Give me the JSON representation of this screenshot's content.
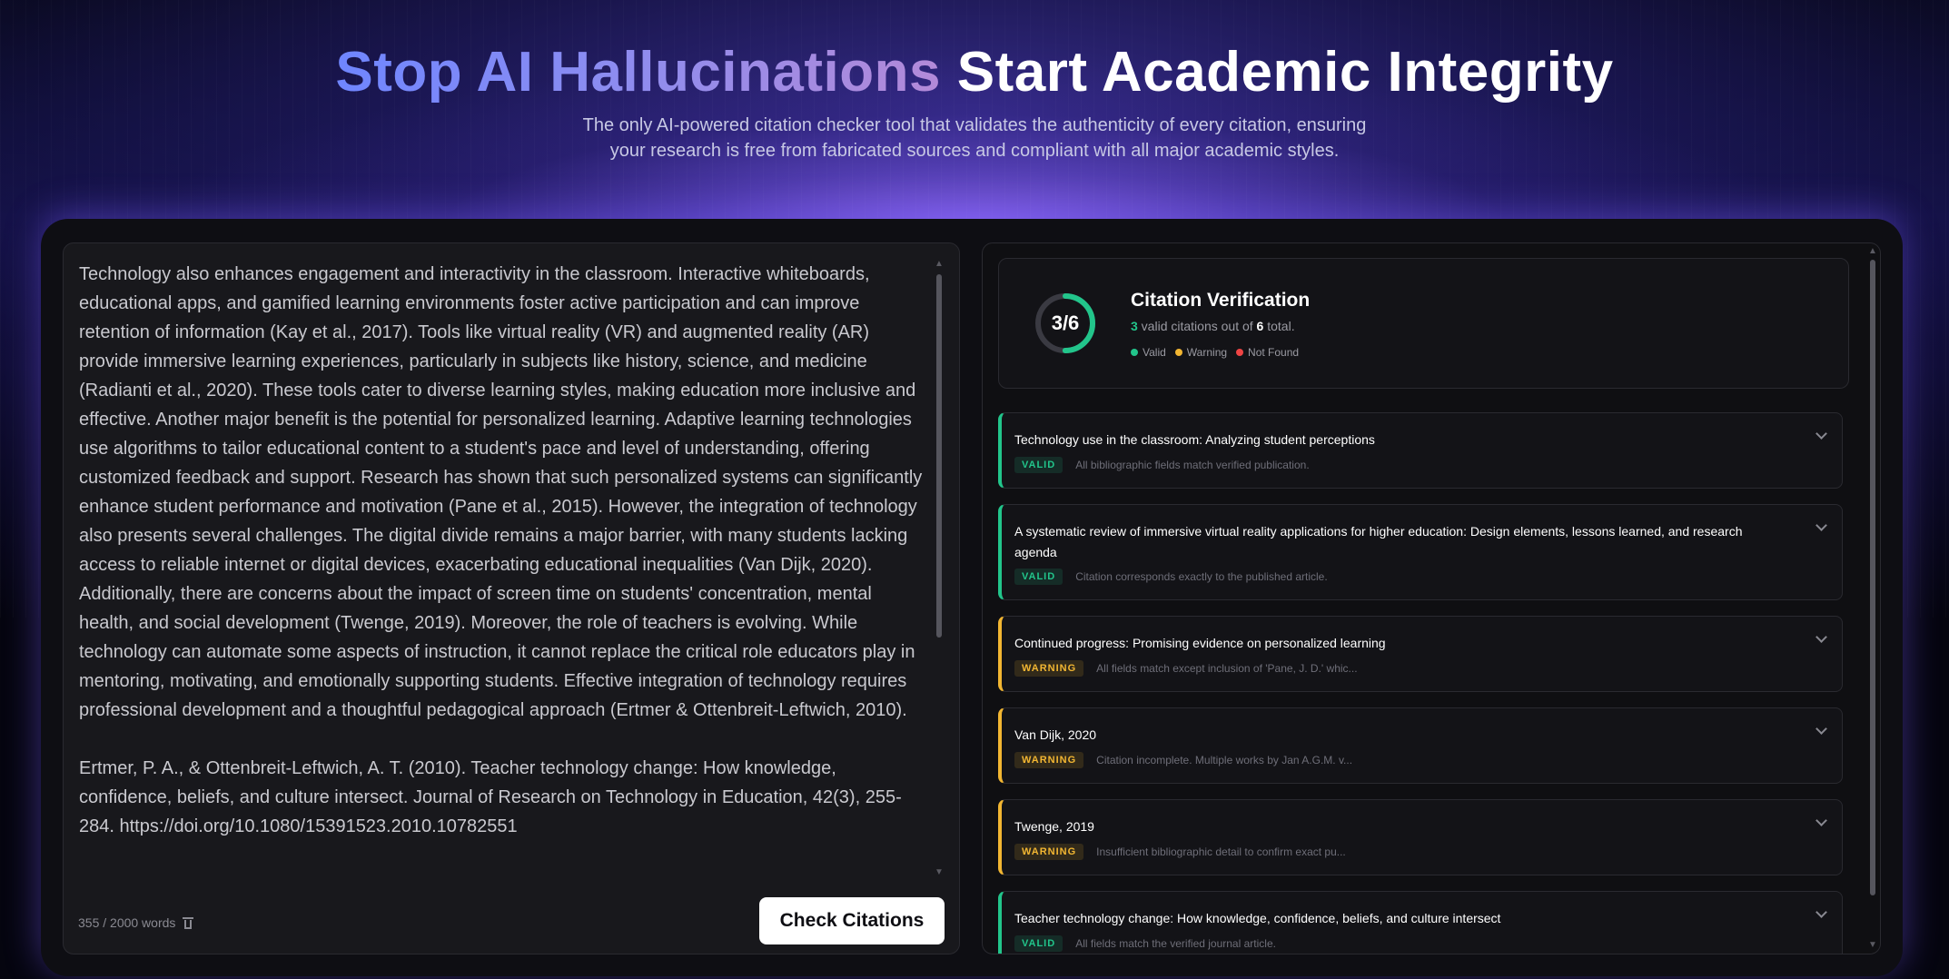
{
  "hero": {
    "title_accent": "Stop AI Hallucinations",
    "title_rest": "Start Academic Integrity",
    "subtitle": "The only AI-powered citation checker tool that validates the authenticity of every citation, ensuring your research is free from fabricated sources and compliant with all major academic styles."
  },
  "editor": {
    "paragraphs": [
      "Technology also enhances engagement and interactivity in the classroom. Interactive whiteboards, educational apps, and gamified learning environments foster active participation and can improve retention of information (Kay et al., 2017). Tools like virtual reality (VR) and augmented reality (AR) provide immersive learning experiences, particularly in subjects like history, science, and medicine (Radianti et al., 2020). These tools cater to diverse learning styles, making education more inclusive and effective. Another major benefit is the potential for personalized learning. Adaptive learning technologies use algorithms to tailor educational content to a student's pace and level of understanding, offering customized feedback and support. Research has shown that such personalized systems can significantly enhance student performance and motivation (Pane et al., 2015). However, the integration of technology also presents several challenges. The digital divide remains a major barrier, with many students lacking access to reliable internet or digital devices, exacerbating educational inequalities (Van Dijk, 2020). Additionally, there are concerns about the impact of screen time on students' concentration, mental health, and social development (Twenge, 2019). Moreover, the role of teachers is evolving. While technology can automate some aspects of instruction, it cannot replace the critical role educators play in mentoring, motivating, and emotionally supporting students. Effective integration of technology requires professional development and a thoughtful pedagogical approach (Ertmer & Ottenbreit-Leftwich, 2010).",
      "Ertmer, P. A., & Ottenbreit-Leftwich, A. T. (2010). Teacher technology change: How knowledge, confidence, beliefs, and culture intersect. Journal of Research on Technology in Education, 42(3), 255-284. https://doi.org/10.1080/15391523.2010.10782551"
    ],
    "word_count": "355 / 2000 words",
    "check_button": "Check Citations"
  },
  "summary": {
    "score": "3/6",
    "valid_fraction": 0.5,
    "title": "Citation Verification",
    "valid_count": "3",
    "mid_text": " valid citations out of ",
    "total_count": "6",
    "end_text": " total.",
    "legend": [
      {
        "label": "Valid",
        "color": "#22c58b"
      },
      {
        "label": "Warning",
        "color": "#f2b632"
      },
      {
        "label": "Not Found",
        "color": "#ef4444"
      }
    ]
  },
  "citations": [
    {
      "title": "Technology use in the classroom: Analyzing student perceptions",
      "status": "VALID",
      "note": "All bibliographic fields match verified publication."
    },
    {
      "title": "A systematic review of immersive virtual reality applications for higher education: Design elements, lessons learned, and research agenda",
      "status": "VALID",
      "note": "Citation corresponds exactly to the published article."
    },
    {
      "title": "Continued progress: Promising evidence on personalized learning",
      "status": "WARNING",
      "note": "All fields match except inclusion of 'Pane, J. D.' whic..."
    },
    {
      "title": "Van Dijk, 2020",
      "status": "WARNING",
      "note": "Citation incomplete. Multiple works by Jan A.G.M. v..."
    },
    {
      "title": "Twenge, 2019",
      "status": "WARNING",
      "note": "Insufficient bibliographic detail to confirm exact pu..."
    },
    {
      "title": "Teacher technology change: How knowledge, confidence, beliefs, and culture intersect",
      "status": "VALID",
      "note": "All fields match the verified journal article."
    }
  ],
  "colors": {
    "valid": "#22c58b",
    "warning": "#f2b632",
    "not_found": "#ef4444",
    "accent": "#7b7cf5"
  }
}
